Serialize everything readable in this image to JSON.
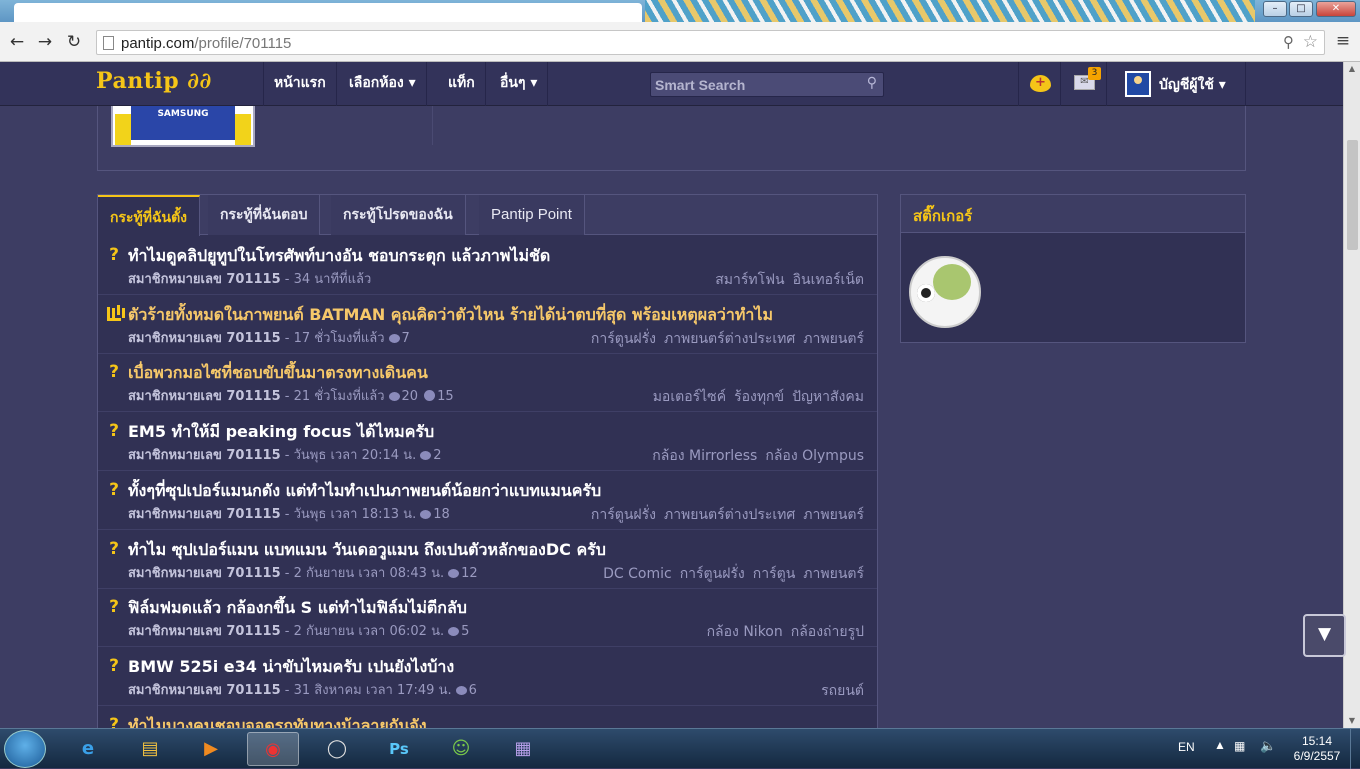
{
  "window": {
    "minimize": "–",
    "maximize": "□",
    "close": "✕"
  },
  "browser": {
    "back_icon": "arrow-left-icon",
    "forward_icon": "arrow-right-icon",
    "reload_icon": "reload-icon",
    "url_host": "pantip.com",
    "url_path": "/profile/701115",
    "zoom_glyph": "⚲",
    "star_glyph": "☆",
    "menu_glyph": "≡"
  },
  "site": {
    "logo": "Pantip ∂∂",
    "nav": [
      "หน้าแรก",
      "เลือกห้อง ▾",
      "แท็ก",
      "อื่นๆ ▾"
    ],
    "search_placeholder": "Smart Search",
    "mail_count": "3",
    "account_label": "บัญชีผู้ใช้ ▾",
    "profile_shirt_text": "SAMSUNG"
  },
  "tabs": [
    {
      "label": "กระทู้ที่ฉันตั้ง",
      "active": true
    },
    {
      "label": "กระทู้ที่ฉันตอบ",
      "active": false
    },
    {
      "label": "กระทู้โปรดของฉัน",
      "active": false
    },
    {
      "label": "Pantip Point",
      "active": false
    }
  ],
  "topics": [
    {
      "icon": "question-icon",
      "title": "ทำไมดูคลิปยูทูปในโทรศัพท์บางอัน ชอบกระตุก แล้วภาพไม่ชัด",
      "hot": false,
      "user": "สมาชิกหมายเลข 701115",
      "time": "- 34 นาทีที่แล้ว",
      "comments": "",
      "votes": "",
      "tags": [
        "สมาร์ทโฟน",
        "อินเทอร์เน็ต"
      ]
    },
    {
      "icon": "poll-icon",
      "title": "ตัวร้ายทั้งหมดในภาพยนต์ BATMAN คุณคิดว่าตัวไหน ร้ายได้น่าตบที่สุด พร้อมเหตุผลว่าทำไม",
      "hot": true,
      "user": "สมาชิกหมายเลข 701115",
      "time": "- 17 ชั่วโมงที่แล้ว",
      "comments": "7",
      "votes": "",
      "tags": [
        "การ์ตูนฝรั่ง",
        "ภาพยนตร์ต่างประเทศ",
        "ภาพยนตร์"
      ]
    },
    {
      "icon": "question-icon",
      "title": "เบื่อพวกมอไซที่ชอบขับขึ้นมาตรงทางเดินคน",
      "hot": true,
      "user": "สมาชิกหมายเลข 701115",
      "time": "- 21 ชั่วโมงที่แล้ว",
      "comments": "20",
      "votes": "15",
      "tags": [
        "มอเตอร์ไซค์",
        "ร้องทุกข์",
        "ปัญหาสังคม"
      ]
    },
    {
      "icon": "question-icon",
      "title": "EM5 ทำให้มี peaking focus ได้ไหมครับ",
      "hot": false,
      "user": "สมาชิกหมายเลข 701115",
      "time": "- วันพุธ เวลา 20:14 น.",
      "comments": "2",
      "votes": "",
      "tags": [
        "กล้อง Mirrorless",
        "กล้อง Olympus"
      ]
    },
    {
      "icon": "question-icon",
      "title": "ทั้งๆที่ซุปเปอร์แมนกดัง แต่ทำไมทำเปนภาพยนต์น้อยกว่าแบทแมนครับ",
      "hot": false,
      "user": "สมาชิกหมายเลข 701115",
      "time": "- วันพุธ เวลา 18:13 น.",
      "comments": "18",
      "votes": "",
      "tags": [
        "การ์ตูนฝรั่ง",
        "ภาพยนตร์ต่างประเทศ",
        "ภาพยนตร์"
      ]
    },
    {
      "icon": "question-icon",
      "title": "ทำไม ซุปเปอร์แมน แบทแมน วันเดอวูแมน ถึงเปนตัวหลักของDC ครับ",
      "hot": false,
      "user": "สมาชิกหมายเลข 701115",
      "time": "- 2 กันยายน เวลา 08:43 น.",
      "comments": "12",
      "votes": "",
      "tags": [
        "DC Comic",
        "การ์ตูนฝรั่ง",
        "การ์ตูน",
        "ภาพยนตร์"
      ]
    },
    {
      "icon": "question-icon",
      "title": "ฟิล์มฟมดแล้ว กล้องกขึ้น S แต่ทำไมฟิล์มไม่ตีกลับ",
      "hot": false,
      "user": "สมาชิกหมายเลข 701115",
      "time": "- 2 กันยายน เวลา 06:02 น.",
      "comments": "5",
      "votes": "",
      "tags": [
        "กล้อง Nikon",
        "กล้องถ่ายรูป"
      ]
    },
    {
      "icon": "question-icon",
      "title": "BMW 525i e34 น่าขับไหมครับ เปนยังไงบ้าง",
      "hot": false,
      "user": "สมาชิกหมายเลข 701115",
      "time": "- 31 สิงหาคม เวลา 17:49 น.",
      "comments": "6",
      "votes": "",
      "tags": [
        "รถยนต์"
      ]
    },
    {
      "icon": "question-icon",
      "title": "ทำไมบางคนชอบจอดรถทับทางม้าลายกันจัง",
      "hot": true,
      "user": "",
      "time": "",
      "comments": "",
      "votes": "",
      "tags": []
    }
  ],
  "sticker_panel": {
    "title": "สติ๊กเกอร์"
  },
  "taskbar": {
    "apps": [
      "windows-start-icon",
      "ie-icon",
      "explorer-icon",
      "media-player-icon",
      "chrome-icon",
      "app-icon",
      "photoshop-icon",
      "messenger-icon",
      "winrar-icon"
    ],
    "ps_label": "Ps",
    "lang": "EN",
    "time": "15:14",
    "date": "6/9/2557"
  }
}
